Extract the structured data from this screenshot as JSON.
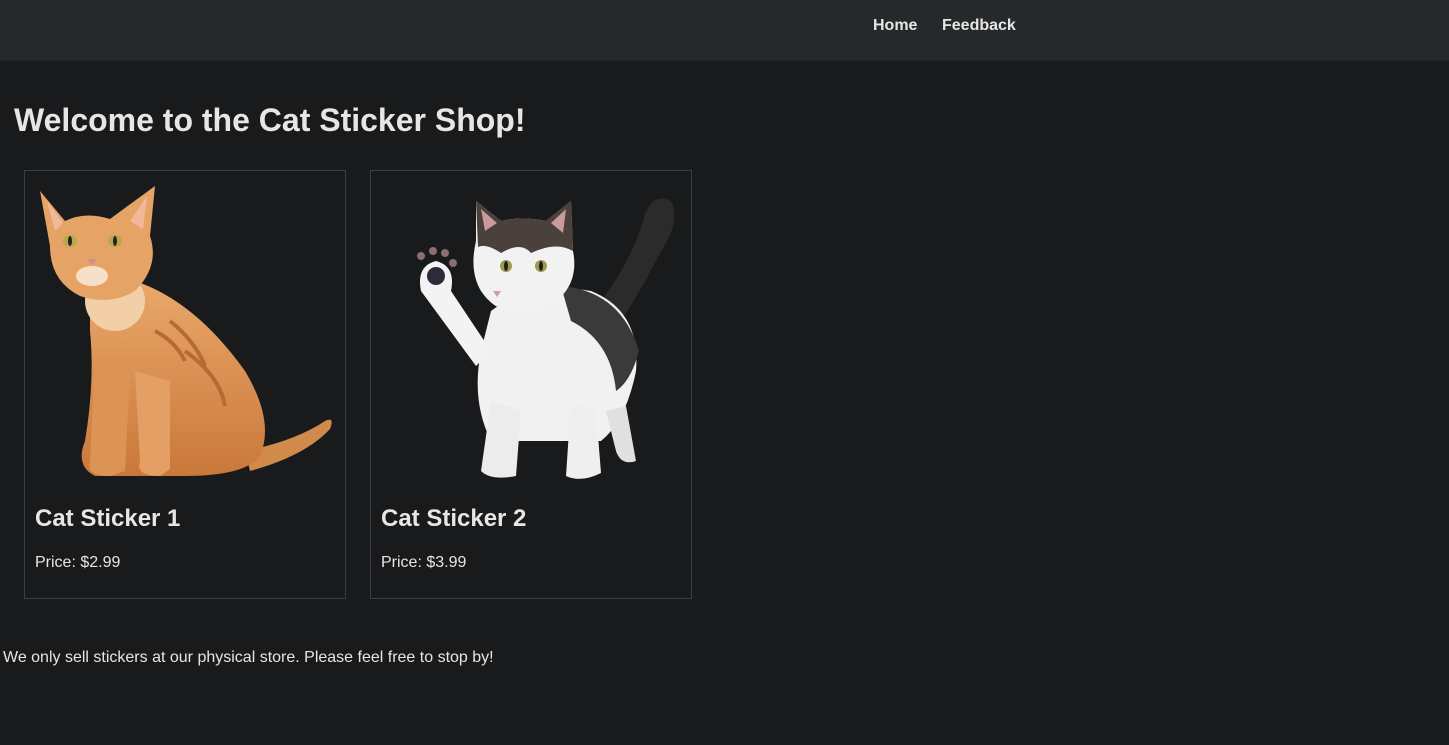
{
  "nav": {
    "home": "Home",
    "feedback": "Feedback"
  },
  "page": {
    "title": "Welcome to the Cat Sticker Shop!",
    "footer_note": "We only sell stickers at our physical store. Please feel free to stop by!"
  },
  "products": [
    {
      "name": "Cat Sticker 1",
      "price": "Price: $2.99",
      "image": "orange-tabby-cat-image"
    },
    {
      "name": "Cat Sticker 2",
      "price": "Price: $3.99",
      "image": "black-white-kitten-image"
    }
  ],
  "colors": {
    "background": "#181a1b",
    "navbar": "#25292b",
    "text": "#e8e6e3",
    "card_border": "#3a3e41"
  }
}
